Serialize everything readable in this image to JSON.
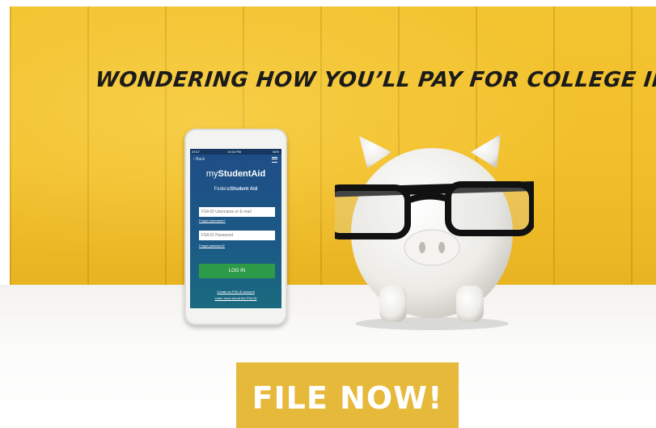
{
  "headline": "WONDERING HOW YOU’LL PAY FOR COLLEGE IN THE FALL?",
  "phone": {
    "status": {
      "carrier": "AT&T",
      "time": "10:34 PM",
      "battery": "54%"
    },
    "back_label": "Back",
    "brand_prefix": "my",
    "brand_name": "StudentAid",
    "fsa_prefix": "Federal",
    "fsa_name": "Student Aid",
    "username_placeholder": "FSA ID Username or E-mail",
    "forgot_username": "Forgot username?",
    "password_placeholder": "FSA ID Password",
    "forgot_password": "Forgot password?",
    "login_label": "LOG IN",
    "create_account": "Create an FSA ID account",
    "learn_more": "Learn more about the FSA ID"
  },
  "cta": {
    "label": "FILE NOW!"
  },
  "colors": {
    "wall": "#f2bf2a",
    "cta": "#e7b93b",
    "login": "#2d9a48",
    "screen": "#1f4d86"
  },
  "icons": [
    "menu-icon",
    "back-chevron-icon",
    "piggy-bank-illustration",
    "glasses-illustration"
  ]
}
